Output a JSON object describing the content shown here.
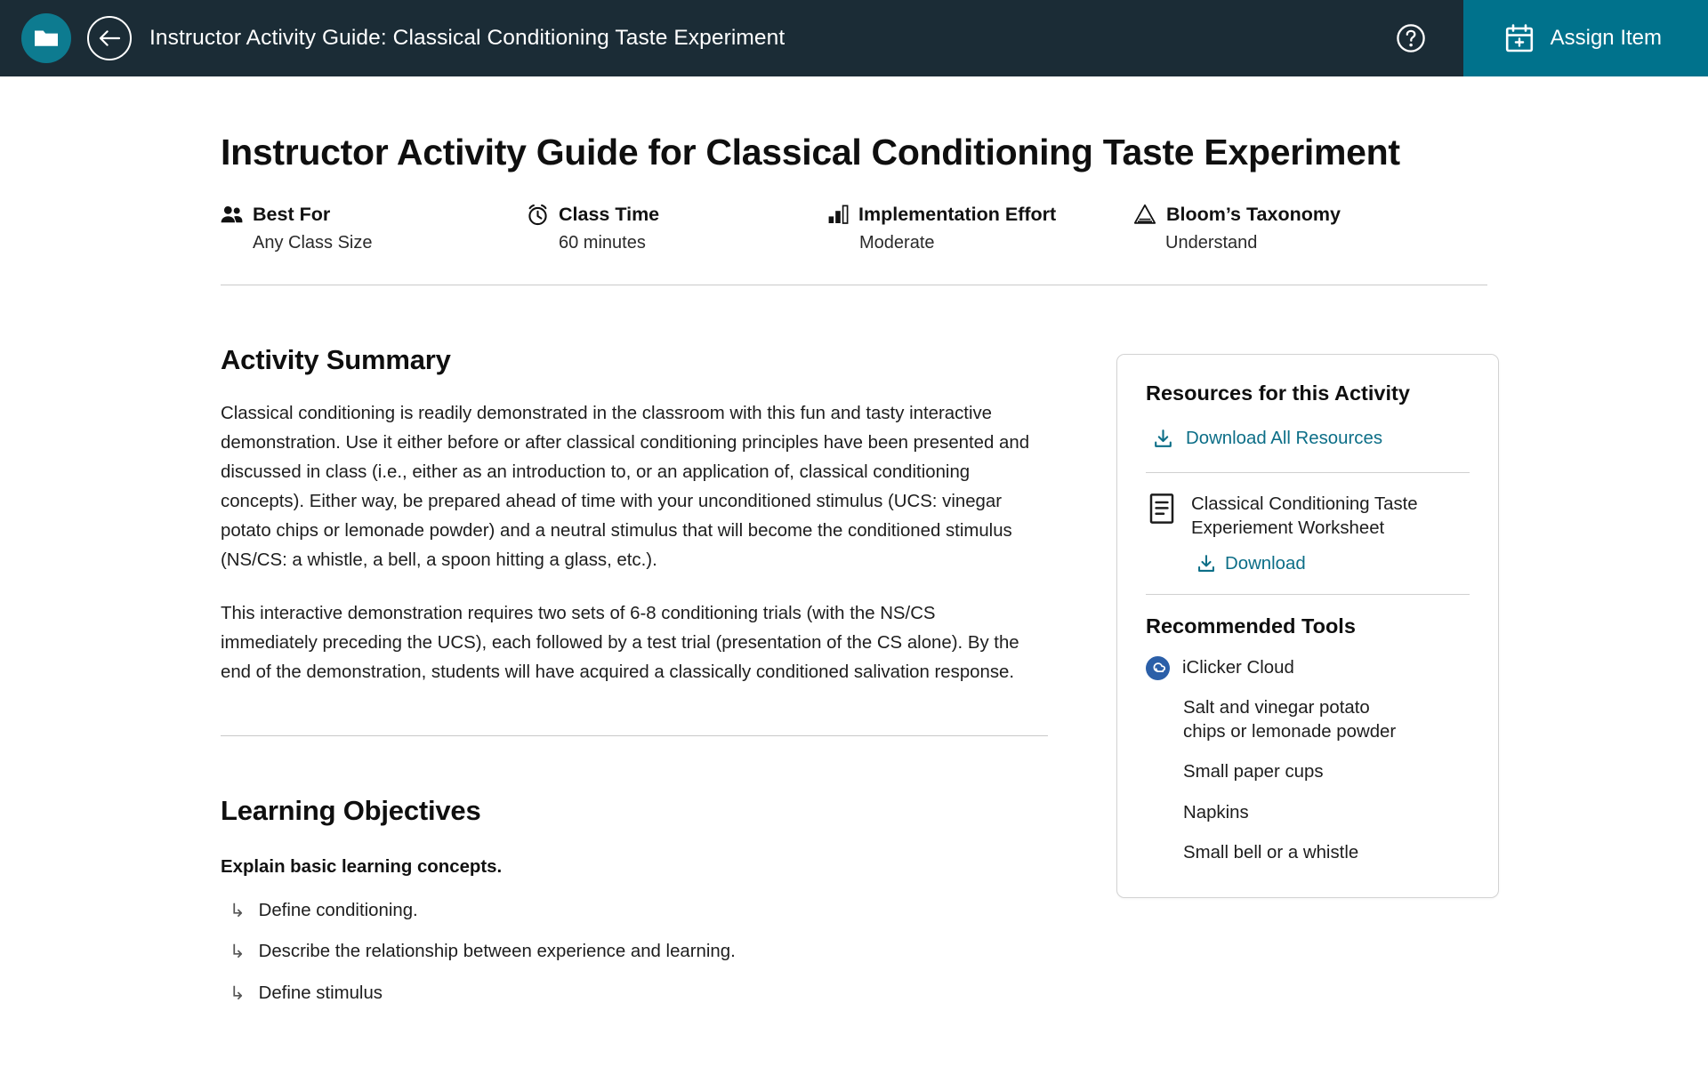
{
  "header": {
    "logo_icon": "folder-icon",
    "back_icon": "arrow-left-icon",
    "title": "Instructor Activity Guide: Classical Conditioning Taste Experiment",
    "help_icon": "help-circle-icon",
    "assign_icon": "calendar-plus-icon",
    "assign_label": "Assign Item",
    "bar_color": "#1b2c36",
    "logo_color": "#0d7b90",
    "assign_color": "#00728c"
  },
  "doc": {
    "title": "Instructor Activity Guide for Classical Conditioning Taste Experiment"
  },
  "meta": [
    {
      "icon": "people-icon",
      "label": "Best For",
      "value": "Any Class Size"
    },
    {
      "icon": "alarm-clock-icon",
      "label": "Class Time",
      "value": "60 minutes"
    },
    {
      "icon": "bar-chart-icon",
      "label": "Implementation Effort",
      "value": "Moderate"
    },
    {
      "icon": "pyramid-icon",
      "label": "Bloom’s Taxonomy",
      "value": "Understand"
    }
  ],
  "summary": {
    "heading": "Activity Summary",
    "paragraph1": "Classical conditioning is readily demonstrated in the classroom with this fun and tasty interactive demonstration. Use it either before or after classical conditioning principles have been presented and discussed in class (i.e., either as an introduction to, or an application of, classical conditioning concepts). Either way, be prepared ahead of time with your unconditioned stimulus (UCS: vinegar potato chips or lemonade powder) and a neutral stimulus that will become the conditioned stimulus (NS/CS: a whistle, a bell, a spoon hitting a glass, etc.).",
    "paragraph2": "This interactive demonstration requires two sets of 6-8 conditioning trials (with the NS/CS immediately preceding the UCS), each followed by a test trial (presentation of the CS alone). By the end of the demonstration, students will have acquired a classically conditioned salivation response."
  },
  "objectives": {
    "heading": "Learning Objectives",
    "group_title": "Explain basic learning concepts.",
    "bullet_glyph": "↳",
    "items": [
      "Define conditioning.",
      "Describe the relationship between experience and learning.",
      "Define stimulus"
    ]
  },
  "resources": {
    "title": "Resources for this Activity",
    "download_all_label": "Download All Resources",
    "download_all_icon": "download-icon",
    "items": [
      {
        "icon": "document-icon",
        "name": "Classical Conditioning Taste Experiement Worksheet",
        "download_label": "Download",
        "download_icon": "download-icon"
      }
    ],
    "link_color": "#0c6e87"
  },
  "tools": {
    "title": "Recommended Tools",
    "primary": {
      "icon": "cloud-icon",
      "name": "iClicker Cloud",
      "badge_color": "#2b5fa8"
    },
    "supplies": [
      "Salt and vinegar potato chips or lemonade powder",
      "Small paper cups",
      "Napkins",
      "Small bell or a whistle"
    ]
  }
}
